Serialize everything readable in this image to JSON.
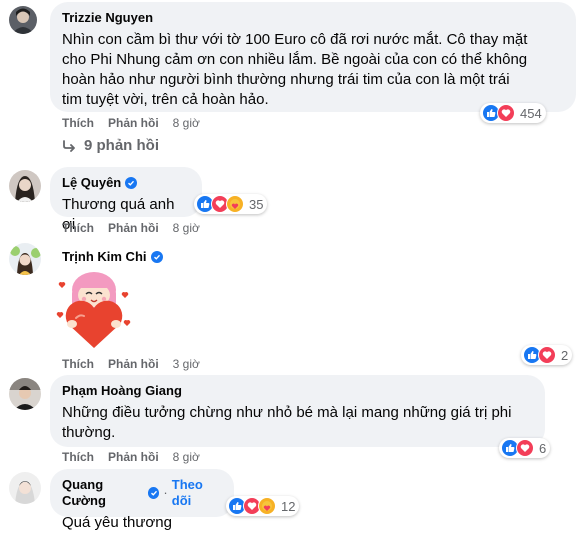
{
  "comments": [
    {
      "name": "Trizzie Nguyen",
      "text_lines": [
        "Nhìn con cầm bì thư với tờ 100 Euro cô đã rơi nước mắt. Cô thay mặt",
        "cho Phi Nhung cảm ơn con nhiều lắm. Bề ngoài của con có thể không",
        "hoàn hảo như người bình thường nhưng trái tim của con là một trái",
        "tim tuyệt vời, trên cả hoàn hảo."
      ],
      "like_label": "Thích",
      "reply_label": "Phản hồi",
      "time": "8 giờ",
      "reaction_count": "454"
    },
    {
      "name": "Lệ Quyên",
      "text": "Thương quá anh ơi",
      "reaction_count": "35",
      "like_label": "Thích",
      "reply_label": "Phản hồi",
      "time": "8 giờ"
    },
    {
      "name": "Trịnh Kim Chi",
      "like_label": "Thích",
      "reply_label": "Phản hồi",
      "time": "3 giờ",
      "reaction_count": "2"
    },
    {
      "name": "Phạm Hoàng Giang",
      "text_lines": [
        "Những điều tưởng chừng như nhỏ bé mà lại mang những giá trị phi",
        "thường."
      ],
      "like_label": "Thích",
      "reply_label": "Phản hồi",
      "time": "8 giờ",
      "reaction_count": "6"
    },
    {
      "name": "Quang Cường",
      "follow_label": "Theo dõi",
      "text": "Quá yêu thương",
      "reaction_count": "12"
    }
  ],
  "view_replies": "9 phản hồi",
  "colors": {
    "bubble": "#f0f2f5",
    "accent": "#1877f2",
    "meta": "#65676b",
    "love": "#f33e58",
    "care": "#f7b125"
  },
  "icons": [
    "reply-arrow-icon",
    "verified-badge-icon",
    "like-reaction-icon",
    "love-reaction-icon",
    "care-reaction-icon",
    "heart-sticker"
  ]
}
